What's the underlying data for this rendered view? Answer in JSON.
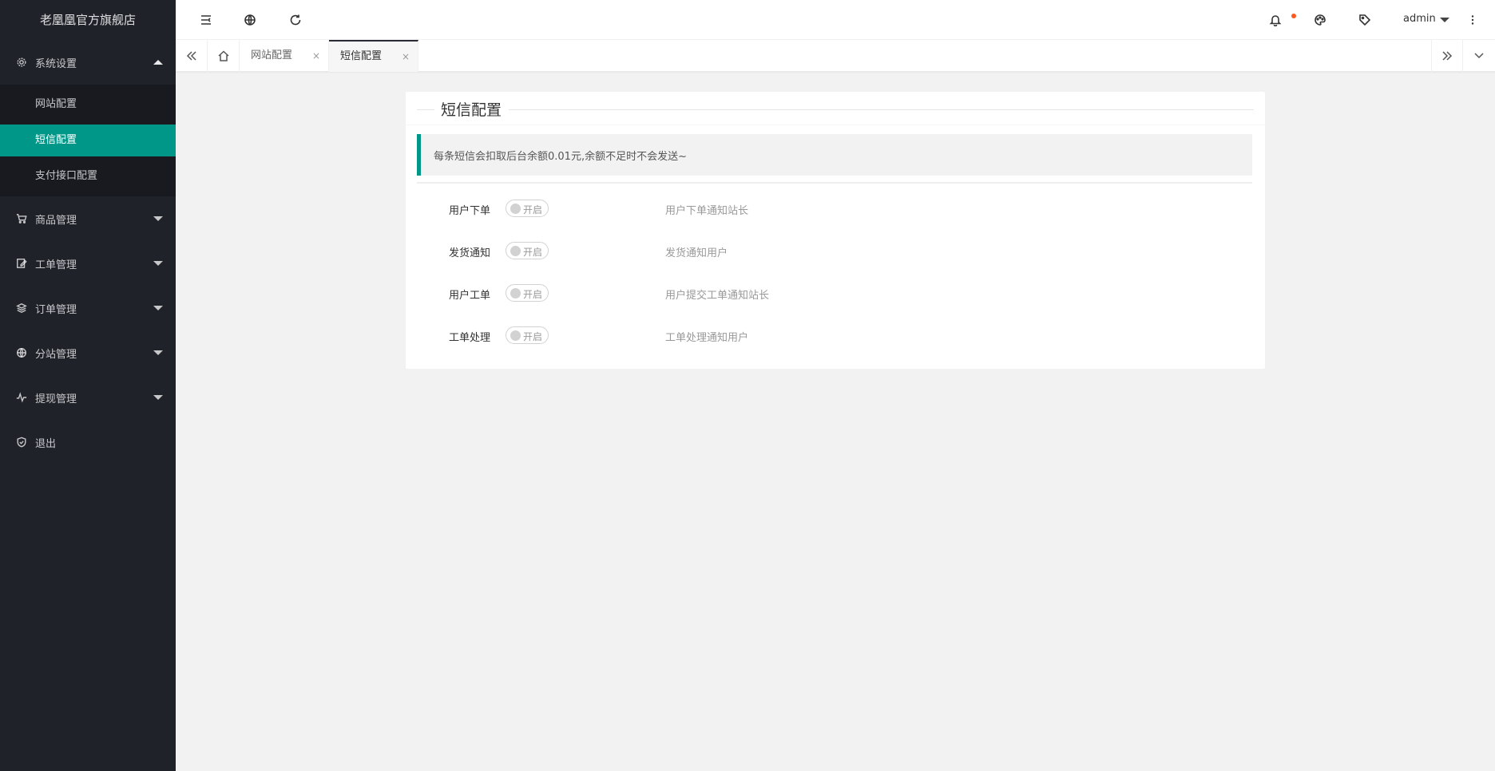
{
  "sidebar": {
    "logo": "老凰凰官方旗舰店",
    "menu": [
      {
        "label": "系统设置",
        "icon": "gear-icon",
        "expanded": true
      },
      {
        "label": "商品管理",
        "icon": "cart-icon"
      },
      {
        "label": "工单管理",
        "icon": "edit-icon"
      },
      {
        "label": "订单管理",
        "icon": "layers-icon"
      },
      {
        "label": "分站管理",
        "icon": "globe-icon"
      },
      {
        "label": "提现管理",
        "icon": "pulse-icon"
      },
      {
        "label": "退出",
        "icon": "shield-check-icon"
      }
    ],
    "submenu": [
      {
        "label": "网站配置"
      },
      {
        "label": "短信配置",
        "active": true
      },
      {
        "label": "支付接口配置"
      }
    ]
  },
  "header": {
    "user": "admin",
    "icons": [
      "menu-toggle-icon",
      "globe-icon",
      "refresh-icon",
      "bell-icon",
      "theme-icon",
      "tag-icon",
      "more-vertical-icon"
    ]
  },
  "tabs": {
    "items": [
      {
        "label": "网站配置",
        "close": "×"
      },
      {
        "label": "短信配置",
        "close": "×",
        "active": true
      }
    ]
  },
  "content": {
    "title": "短信配置",
    "notice": "每条短信会扣取后台余额0.01元,余额不足时不会发送~",
    "switch_text": "开启",
    "rows": [
      {
        "label": "用户下单",
        "desc": "用户下单通知站长",
        "on": false
      },
      {
        "label": "发货通知",
        "desc": "发货通知用户",
        "on": false
      },
      {
        "label": "用户工单",
        "desc": "用户提交工单通知站长",
        "on": false
      },
      {
        "label": "工单处理",
        "desc": "工单处理通知用户",
        "on": false
      }
    ]
  },
  "colors": {
    "sidebar_bg": "#20222a",
    "submenu_bg": "#181a20",
    "accent": "#009688",
    "notify_dot": "#ff5722"
  }
}
